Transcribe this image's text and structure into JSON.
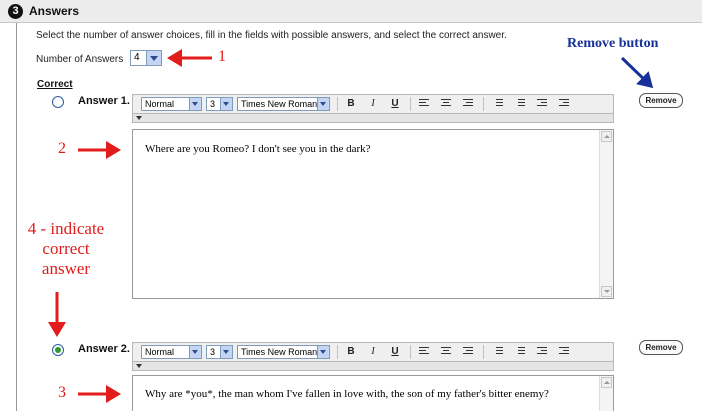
{
  "section": {
    "step_number": "3",
    "title": "Answers"
  },
  "instructions": "Select the number of answer choices, fill in the fields with possible answers, and select the correct answer.",
  "num_answers": {
    "label": "Number of Answers",
    "value": "4"
  },
  "correct_label": "Correct",
  "toolbar": {
    "style_value": "Normal",
    "size_value": "3",
    "font_value": "Times New Roman",
    "bold_label": "B",
    "italic_label": "I",
    "underline_label": "U"
  },
  "answers": [
    {
      "label": "Answer 1.",
      "text": "Where are you Romeo?  I don't see you in the dark?",
      "correct": false,
      "remove_label": "Remove"
    },
    {
      "label": "Answer 2.",
      "text": "Why are *you*, the man whom I've fallen in love with, the son of my father's bitter enemy?",
      "correct": true,
      "remove_label": "Remove"
    }
  ],
  "annotations": {
    "a1": "1",
    "a2": "2",
    "a3": "3",
    "a4_line1": "4 - indicate",
    "a4_line2": "correct",
    "a4_line3": "answer",
    "remove": "Remove button"
  },
  "colors": {
    "annotation_red": "#e21b1b",
    "annotation_blue": "#17319a",
    "radio_checked": "#2e9a2e"
  }
}
